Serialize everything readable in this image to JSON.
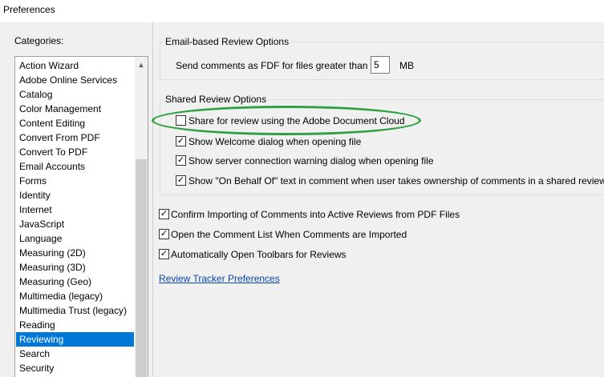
{
  "window": {
    "title": "Preferences"
  },
  "categories": {
    "label": "Categories:",
    "items": [
      "Action Wizard",
      "Adobe Online Services",
      "Catalog",
      "Color Management",
      "Content Editing",
      "Convert From PDF",
      "Convert To PDF",
      "Email Accounts",
      "Forms",
      "Identity",
      "Internet",
      "JavaScript",
      "Language",
      "Measuring (2D)",
      "Measuring (3D)",
      "Measuring (Geo)",
      "Multimedia (legacy)",
      "Multimedia Trust (legacy)",
      "Reading",
      "Reviewing",
      "Search",
      "Security"
    ],
    "selected": "Reviewing",
    "scroll_up_glyph": "▲"
  },
  "email_review": {
    "title": "Email-based Review Options",
    "send_label": "Send comments as FDF for files greater than",
    "size_value": "5",
    "size_unit": "MB"
  },
  "shared_review": {
    "title": "Shared Review Options",
    "options": [
      {
        "label": "Share for review using the Adobe Document Cloud",
        "checked": false
      },
      {
        "label": "Show Welcome dialog when opening file",
        "checked": true
      },
      {
        "label": "Show server connection warning dialog when opening file",
        "checked": true
      },
      {
        "label": "Show \"On Behalf Of\" text in comment when user takes ownership of comments in a shared review",
        "checked": true
      }
    ]
  },
  "general_options": [
    {
      "label": "Confirm Importing of Comments into Active Reviews from PDF Files",
      "checked": true
    },
    {
      "label": "Open the Comment List When Comments are Imported",
      "checked": true
    },
    {
      "label": "Automatically Open Toolbars for Reviews",
      "checked": true
    }
  ],
  "tracker_link": "Review Tracker Preferences",
  "check_glyph": "✓",
  "colors": {
    "selection": "#0078d7",
    "highlight_ellipse": "#2ea043",
    "link": "#0645ad"
  }
}
